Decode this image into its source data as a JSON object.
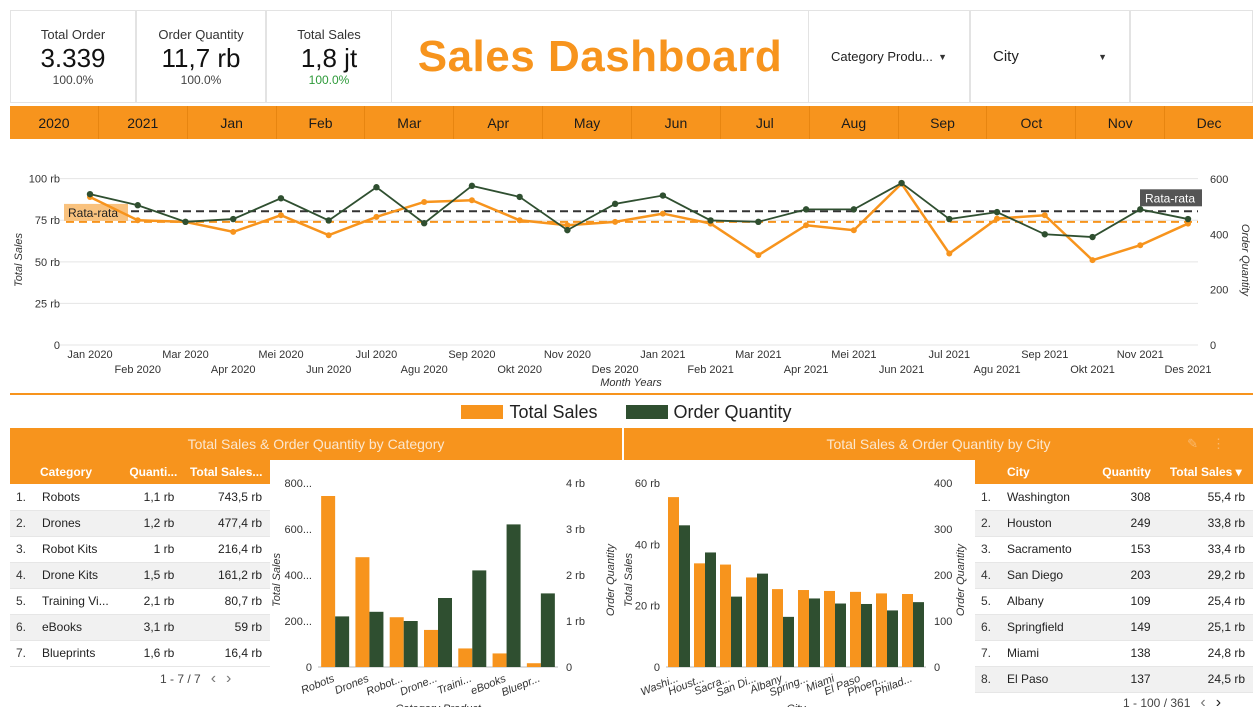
{
  "kpis": [
    {
      "label": "Total Order",
      "value": "3.339",
      "pct": "100.0%"
    },
    {
      "label": "Order Quantity",
      "value": "11,7 rb",
      "pct": "100.0%"
    },
    {
      "label": "Total Sales",
      "value": "1,8 jt",
      "pct": "100.0%"
    }
  ],
  "title": "Sales Dashboard",
  "filters": {
    "category": "Category Produ...",
    "city": "City"
  },
  "colors": {
    "orange": "#f7941d",
    "green": "#2f4f30",
    "pct_green": "#2e9a3a"
  },
  "month_bar": [
    "2020",
    "2021",
    "Jan",
    "Feb",
    "Mar",
    "Apr",
    "May",
    "Jun",
    "Jul",
    "Aug",
    "Sep",
    "Oct",
    "Nov",
    "Dec"
  ],
  "chart_data": [
    {
      "type": "line",
      "x": [
        "Jan 2020",
        "Feb 2020",
        "Mar 2020",
        "Apr 2020",
        "Mei 2020",
        "Jun 2020",
        "Jul 2020",
        "Agu 2020",
        "Sep 2020",
        "Okt 2020",
        "Nov 2020",
        "Des 2020",
        "Jan 2021",
        "Feb 2021",
        "Mar 2021",
        "Apr 2021",
        "Mei 2021",
        "Jun 2021",
        "Jul 2021",
        "Agu 2021",
        "Sep 2021",
        "Okt 2021",
        "Nov 2021",
        "Des 2021"
      ],
      "series": [
        {
          "name": "Total Sales",
          "axis": "left",
          "values": [
            89,
            75,
            74,
            68,
            78,
            66,
            77,
            86,
            87,
            75,
            72,
            74,
            79,
            73,
            54,
            72,
            69,
            97,
            55,
            76,
            78,
            51,
            60,
            73
          ]
        },
        {
          "name": "Order Quantity",
          "axis": "right",
          "values": [
            545,
            505,
            445,
            455,
            530,
            450,
            570,
            440,
            575,
            535,
            415,
            510,
            540,
            450,
            445,
            490,
            490,
            585,
            455,
            480,
            400,
            390,
            490,
            455
          ]
        }
      ],
      "reference_lines": [
        {
          "label": "Rata-rata",
          "axis": "left",
          "value": 74
        },
        {
          "label": "Rata-rata",
          "axis": "right",
          "value": 483
        }
      ],
      "xlabel": "Month Years",
      "ylabel": "Total Sales",
      "ylabel_right": "Order Quantity",
      "yticks": [
        "0",
        "25 rb",
        "50 rb",
        "75 rb",
        "100 rb"
      ],
      "yticks_right": [
        "0",
        "200",
        "400",
        "600"
      ],
      "ylim": [
        0,
        104
      ],
      "ylim_right": [
        0,
        625
      ],
      "grid": true
    },
    {
      "type": "bar",
      "categories": [
        "Robots",
        "Drones",
        "Robot...",
        "Drone...",
        "Traini...",
        "eBooks",
        "Bluepr..."
      ],
      "series": [
        {
          "name": "Total Sales",
          "axis": "left",
          "values": [
            743.5,
            477.4,
            216.4,
            161.2,
            80.7,
            59,
            16.4
          ]
        },
        {
          "name": "Order Quantity",
          "axis": "right",
          "values": [
            1.1,
            1.2,
            1,
            1.5,
            2.1,
            3.1,
            1.6
          ]
        }
      ],
      "xlabel": "Category Product",
      "ylabel": "Total Sales",
      "ylabel_right": "Order Quantity",
      "yticks": [
        "0",
        "200...",
        "400...",
        "600...",
        "800..."
      ],
      "yticks_right": [
        "0",
        "1 rb",
        "2 rb",
        "3 rb",
        "4 rb"
      ],
      "ylim": [
        0,
        800
      ],
      "ylim_right": [
        0,
        4
      ]
    },
    {
      "type": "bar",
      "categories": [
        "Washi...",
        "Houst...",
        "Sacra...",
        "San Di...",
        "Albany",
        "Spring...",
        "Miami",
        "El Paso",
        "Phoen...",
        "Philad..."
      ],
      "series": [
        {
          "name": "Total Sales",
          "axis": "left",
          "values": [
            55.4,
            33.8,
            33.4,
            29.2,
            25.4,
            25.1,
            24.8,
            24.5,
            24.0,
            23.8
          ]
        },
        {
          "name": "Order Quantity",
          "axis": "right",
          "values": [
            308,
            249,
            153,
            203,
            109,
            149,
            138,
            137,
            123,
            141
          ]
        }
      ],
      "xlabel": "City",
      "ylabel": "Total Sales",
      "ylabel_right": "Order Quantity",
      "yticks": [
        "0",
        "20 rb",
        "40 rb",
        "60 rb"
      ],
      "yticks_right": [
        "0",
        "100",
        "200",
        "300",
        "400"
      ],
      "ylim": [
        0,
        60
      ],
      "ylim_right": [
        0,
        400
      ]
    }
  ],
  "legend": [
    "Total Sales",
    "Order Quantity"
  ],
  "category_panel": {
    "title": "Total Sales & Order Quantity by Category",
    "columns": [
      "Category",
      "Quanti...",
      "Total Sales..."
    ],
    "rows": [
      [
        "1.",
        "Robots",
        "1,1 rb",
        "743,5 rb"
      ],
      [
        "2.",
        "Drones",
        "1,2 rb",
        "477,4 rb"
      ],
      [
        "3.",
        "Robot Kits",
        "1 rb",
        "216,4 rb"
      ],
      [
        "4.",
        "Drone Kits",
        "1,5 rb",
        "161,2 rb"
      ],
      [
        "5.",
        "Training Vi...",
        "2,1 rb",
        "80,7 rb"
      ],
      [
        "6.",
        "eBooks",
        "3,1 rb",
        "59 rb"
      ],
      [
        "7.",
        "Blueprints",
        "1,6 rb",
        "16,4 rb"
      ]
    ],
    "pager": "1 - 7 / 7"
  },
  "city_panel": {
    "title": "Total Sales & Order Quantity by City",
    "columns": [
      "City",
      "Quantity",
      "Total Sales ▾"
    ],
    "rows": [
      [
        "1.",
        "Washington",
        "308",
        "55,4 rb"
      ],
      [
        "2.",
        "Houston",
        "249",
        "33,8 rb"
      ],
      [
        "3.",
        "Sacramento",
        "153",
        "33,4 rb"
      ],
      [
        "4.",
        "San Diego",
        "203",
        "29,2 rb"
      ],
      [
        "5.",
        "Albany",
        "109",
        "25,4 rb"
      ],
      [
        "6.",
        "Springfield",
        "149",
        "25,1 rb"
      ],
      [
        "7.",
        "Miami",
        "138",
        "24,8 rb"
      ],
      [
        "8.",
        "El Paso",
        "137",
        "24,5 rb"
      ]
    ],
    "pager": "1 - 100 / 361"
  }
}
